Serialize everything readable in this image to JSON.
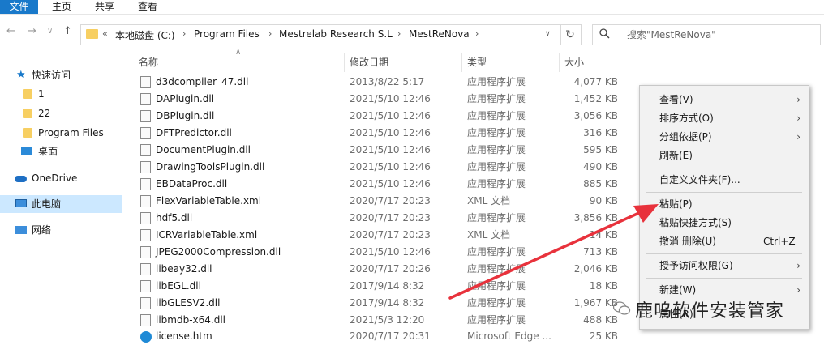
{
  "ribbon": {
    "tabs": [
      {
        "label": "文件"
      },
      {
        "label": "主页"
      },
      {
        "label": "共享"
      },
      {
        "label": "查看"
      }
    ]
  },
  "nav_buttons": {
    "back": "←",
    "forward": "→",
    "up_history": "∨",
    "up": "↑"
  },
  "address": {
    "overflow": "«",
    "crumbs": [
      "本地磁盘 (C:)",
      "Program Files",
      "Mestrelab Research S.L",
      "MestReNova"
    ],
    "separator": "›",
    "dropdown": "∨",
    "refresh": "↻"
  },
  "search": {
    "placeholder": "搜索\"MestReNova\""
  },
  "sidebar": {
    "items": [
      {
        "label": "快速访问",
        "icon": "star-icon"
      },
      {
        "label": "1",
        "icon": "folder-icon"
      },
      {
        "label": "22",
        "icon": "folder-icon"
      },
      {
        "label": "Program Files",
        "icon": "folder-icon"
      },
      {
        "label": "桌面",
        "icon": "desktop-icon"
      },
      {
        "label": "OneDrive",
        "icon": "cloud-icon"
      },
      {
        "label": "此电脑",
        "icon": "computer-icon"
      },
      {
        "label": "网络",
        "icon": "network-icon"
      }
    ]
  },
  "columns": {
    "name": "名称",
    "date": "修改日期",
    "type": "类型",
    "size": "大小"
  },
  "files": [
    {
      "name": "d3dcompiler_47.dll",
      "date": "2013/8/22 5:17",
      "type": "应用程序扩展",
      "size": "4,077 KB"
    },
    {
      "name": "DAPlugin.dll",
      "date": "2021/5/10 12:46",
      "type": "应用程序扩展",
      "size": "1,452 KB"
    },
    {
      "name": "DBPlugin.dll",
      "date": "2021/5/10 12:46",
      "type": "应用程序扩展",
      "size": "3,056 KB"
    },
    {
      "name": "DFTPredictor.dll",
      "date": "2021/5/10 12:46",
      "type": "应用程序扩展",
      "size": "316 KB"
    },
    {
      "name": "DocumentPlugin.dll",
      "date": "2021/5/10 12:46",
      "type": "应用程序扩展",
      "size": "595 KB"
    },
    {
      "name": "DrawingToolsPlugin.dll",
      "date": "2021/5/10 12:46",
      "type": "应用程序扩展",
      "size": "490 KB"
    },
    {
      "name": "EBDataProc.dll",
      "date": "2021/5/10 12:46",
      "type": "应用程序扩展",
      "size": "885 KB"
    },
    {
      "name": "FlexVariableTable.xml",
      "date": "2020/7/17 20:23",
      "type": "XML 文档",
      "size": "90 KB"
    },
    {
      "name": "hdf5.dll",
      "date": "2020/7/17 20:23",
      "type": "应用程序扩展",
      "size": "3,856 KB"
    },
    {
      "name": "ICRVariableTable.xml",
      "date": "2020/7/17 20:23",
      "type": "XML 文档",
      "size": "14 KB"
    },
    {
      "name": "JPEG2000Compression.dll",
      "date": "2021/5/10 12:46",
      "type": "应用程序扩展",
      "size": "713 KB"
    },
    {
      "name": "libeay32.dll",
      "date": "2020/7/17 20:26",
      "type": "应用程序扩展",
      "size": "2,046 KB"
    },
    {
      "name": "libEGL.dll",
      "date": "2017/9/14 8:32",
      "type": "应用程序扩展",
      "size": "18 KB"
    },
    {
      "name": "libGLESV2.dll",
      "date": "2017/9/14 8:32",
      "type": "应用程序扩展",
      "size": "1,967 KB"
    },
    {
      "name": "libmdb-x64.dll",
      "date": "2021/5/3 12:20",
      "type": "应用程序扩展",
      "size": "488 KB"
    },
    {
      "name": "license.htm",
      "date": "2020/7/17 20:31",
      "type": "Microsoft Edge ...",
      "size": "25 KB"
    }
  ],
  "context_menu": {
    "items": [
      {
        "label": "查看(V)",
        "submenu": true
      },
      {
        "label": "排序方式(O)",
        "submenu": true
      },
      {
        "label": "分组依据(P)",
        "submenu": true
      },
      {
        "label": "刷新(E)",
        "submenu": false
      },
      {
        "label": "自定义文件夹(F)...",
        "submenu": false
      },
      {
        "label": "粘贴(P)",
        "submenu": false
      },
      {
        "label": "粘贴快捷方式(S)",
        "submenu": false
      },
      {
        "label": "撤消 删除(U)",
        "submenu": false,
        "shortcut": "Ctrl+Z"
      },
      {
        "label": "授予访问权限(G)",
        "submenu": true
      },
      {
        "label": "新建(W)",
        "submenu": true
      },
      {
        "label": "属性(R)",
        "submenu": false
      }
    ],
    "submenu_arrow": "›"
  },
  "watermark": {
    "text": "鹿呜软件安装管家"
  },
  "colors": {
    "accent": "#1979ca",
    "selected": "#cce8ff",
    "folder": "#f7cf62",
    "arrow": "#e8323c"
  }
}
